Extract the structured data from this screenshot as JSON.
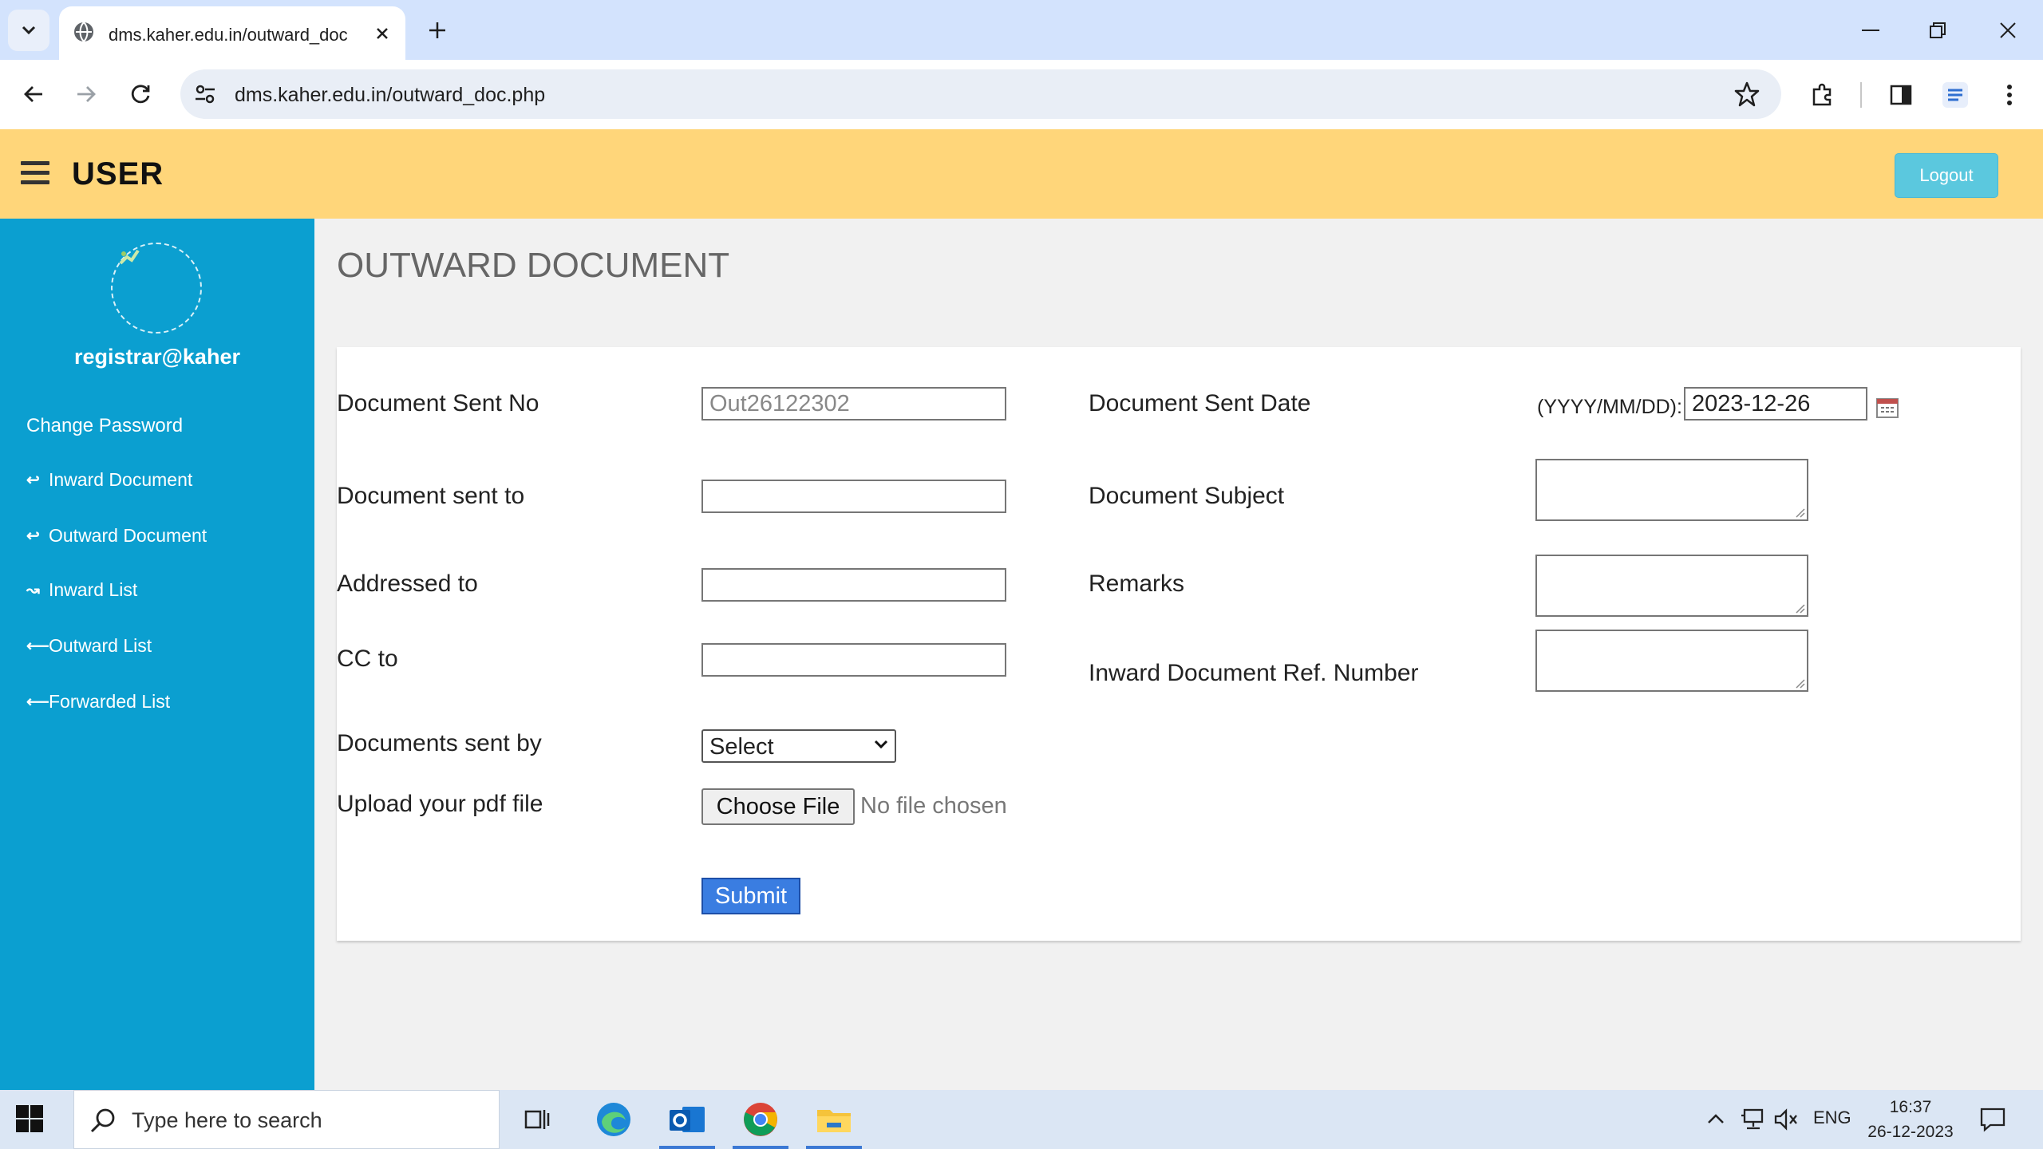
{
  "browser": {
    "tab_title": "dms.kaher.edu.in/outward_doc.php",
    "url": "dms.kaher.edu.in/outward_doc.php"
  },
  "header": {
    "brand": "USER",
    "logout_label": "Logout"
  },
  "sidebar": {
    "username": "registrar@kaher",
    "items": [
      {
        "label": "Change Password",
        "icon": "none"
      },
      {
        "label": "Inward Document",
        "icon": "return-arrow-icon"
      },
      {
        "label": "Outward Document",
        "icon": "return-arrow-icon"
      },
      {
        "label": "Inward List",
        "icon": "wavy-arrow-icon"
      },
      {
        "label": "Outward List",
        "icon": "left-arrow-icon"
      },
      {
        "label": "Forwarded List",
        "icon": "left-arrow-icon"
      }
    ]
  },
  "page": {
    "title": "OUTWARD DOCUMENT"
  },
  "form": {
    "doc_sent_no_label": "Document Sent No",
    "doc_sent_no_value": "Out26122302",
    "doc_sent_date_label": "Document Sent Date",
    "date_format_hint": "(YYYY/MM/DD):",
    "doc_sent_date_value": "2023-12-26",
    "doc_sent_to_label": "Document sent to",
    "doc_sent_to_value": "",
    "doc_subject_label": "Document Subject",
    "addressed_to_label": "Addressed to",
    "addressed_to_value": "",
    "remarks_label": "Remarks",
    "cc_to_label": "CC to",
    "cc_to_value": "",
    "inward_ref_label": "Inward Document Ref. Number",
    "sent_by_label": "Documents sent by",
    "sent_by_selected": "Select",
    "upload_label": "Upload your pdf file",
    "choose_file_label": "Choose File",
    "no_file_text": "No file chosen",
    "submit_label": "Submit"
  },
  "taskbar": {
    "search_placeholder": "Type here to search",
    "language": "ENG",
    "time": "16:37",
    "date": "26-12-2023"
  },
  "colors": {
    "header_bg": "#ffd67a",
    "sidebar_bg": "#0b9fd0",
    "logout_bg": "#5bc8de",
    "submit_bg": "#3a7de1"
  }
}
